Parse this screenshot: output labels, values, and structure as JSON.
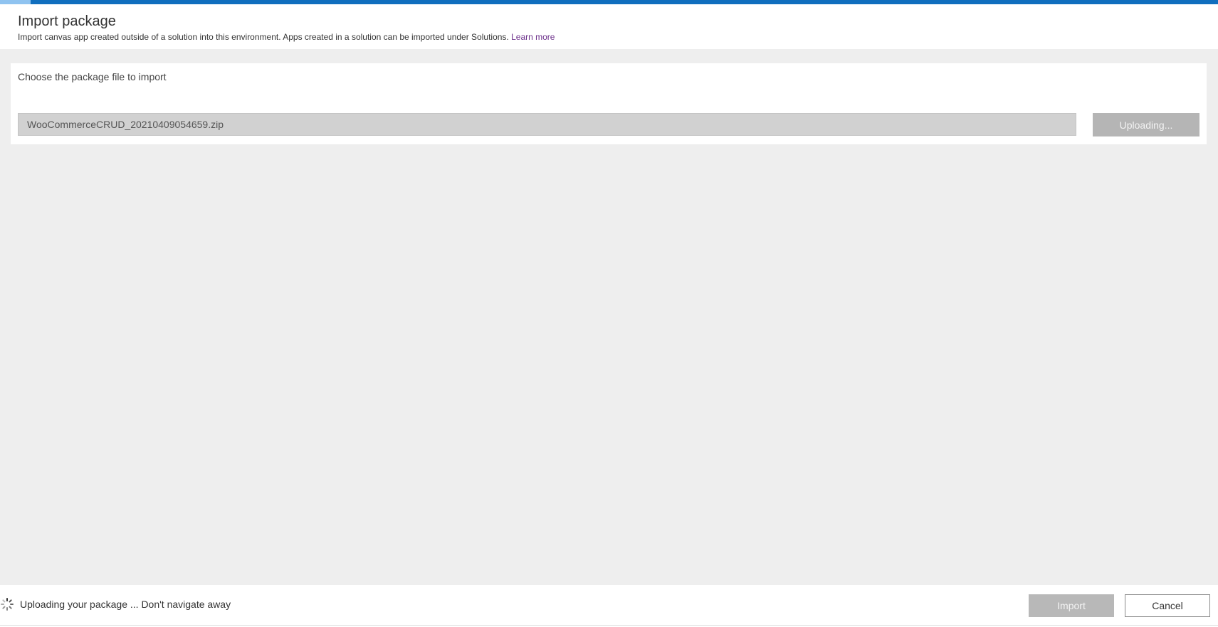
{
  "header": {
    "title": "Import package",
    "subtitle": "Import canvas app created outside of a solution into this environment. Apps created in a solution can be imported under Solutions.",
    "learn_more_label": "Learn more"
  },
  "file_picker": {
    "label": "Choose the package file to import",
    "file_name": "WooCommerceCRUD_20210409054659.zip",
    "upload_button_label": "Uploading..."
  },
  "footer": {
    "status_icon": "spinner-icon",
    "status_text": "Uploading your package ... Don't navigate away",
    "import_label": "Import",
    "cancel_label": "Cancel"
  },
  "colors": {
    "accent": "#106ebe",
    "progress_fill": "#8fc3f0",
    "link": "#6b2f8a",
    "background": "#eeeeee",
    "disabled_button": "#b5b5b5"
  }
}
